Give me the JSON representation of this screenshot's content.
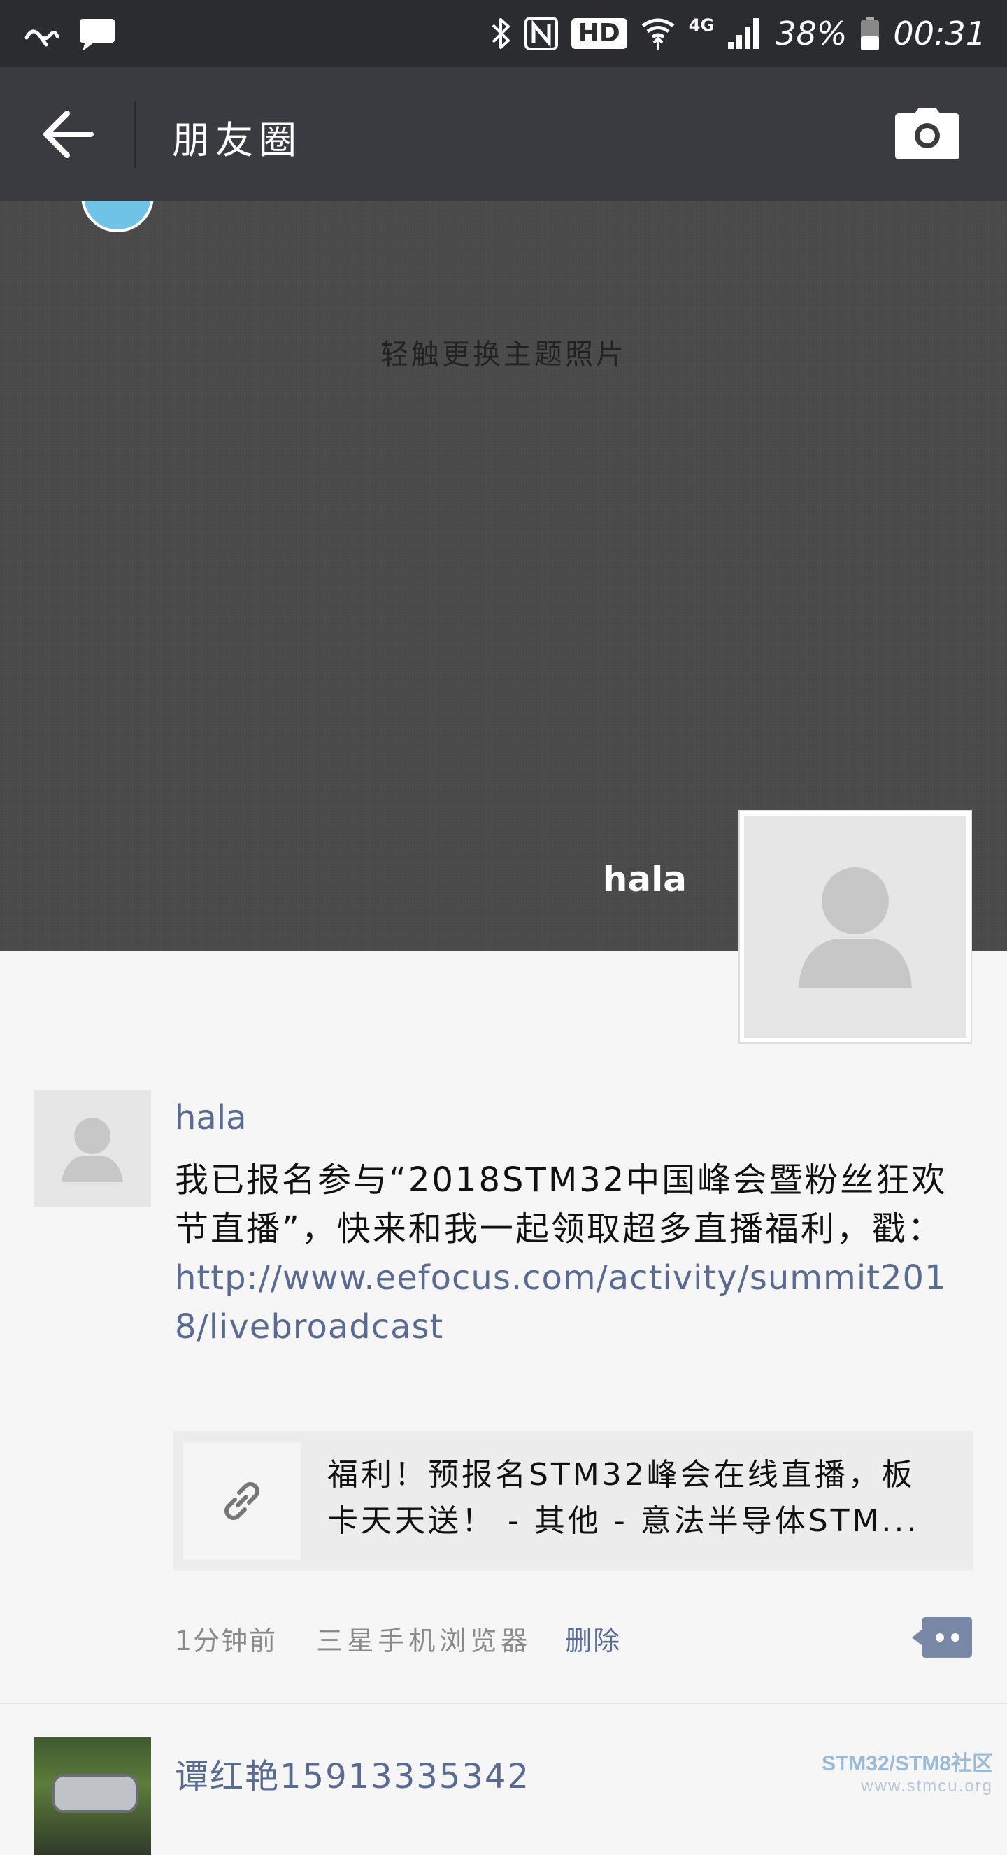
{
  "status_bar": {
    "battery": "38%",
    "time": "00:31",
    "hd": "HD",
    "network": "4G"
  },
  "title_bar": {
    "title": "朋友圈"
  },
  "cover": {
    "hint": "轻触更换主题照片",
    "username": "hala"
  },
  "post": {
    "author": "hala",
    "text": "我已报名参与“2018STM32中国峰会暨粉丝狂欢节直播”，快来和我一起领取超多直播福利，戳：",
    "link": "http://www.eefocus.com/activity/summit2018/livebroadcast",
    "card_title": "福利！预报名STM32峰会在线直播，板卡天天送！ - 其他 - 意法半导体STM...",
    "time": "1分钟前",
    "source": "三星手机浏览器",
    "delete_label": "删除"
  },
  "next_post": {
    "author": "谭红艳15913335342"
  },
  "watermark": {
    "line1": "STM32/STM8社区",
    "line2": "www.stmcu.org"
  }
}
